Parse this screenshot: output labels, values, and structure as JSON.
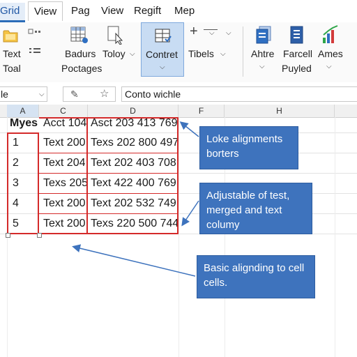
{
  "tabs": [
    {
      "label": "Grid"
    },
    {
      "label": "View"
    },
    {
      "label": "Pag"
    },
    {
      "label": "View"
    },
    {
      "label": "Regift"
    },
    {
      "label": "Mep"
    }
  ],
  "ribbon": {
    "text_tool": [
      "Text",
      "Toal"
    ],
    "badurs": [
      "Badurs",
      "Poctages"
    ],
    "toloy": "Toloy",
    "contret": "Contret",
    "tibels": "Tibels",
    "ahtre": "Ahtre",
    "farcell": [
      "Farcell",
      "Puyled"
    ],
    "ames": "Ames"
  },
  "formula_bar": {
    "name_box": "le",
    "content": "Conto wichle"
  },
  "columns": [
    "A",
    "C",
    "D",
    "F",
    "H"
  ],
  "table": {
    "header": [
      "Myes",
      "Acct 104",
      "Asct 203 413 769"
    ],
    "rows": [
      [
        "1",
        "Text 200",
        "Texs 202 800 497"
      ],
      [
        "2",
        "Text 204",
        "Text 202 403 708"
      ],
      [
        "3",
        "Texs 205",
        "Text 422 400 769"
      ],
      [
        "4",
        "Text 200",
        "Text 202 532 749"
      ],
      [
        "5",
        "Text 200",
        "Texs 220 500 744"
      ]
    ]
  },
  "callouts": {
    "c1": "Loke alignments borters",
    "c2": "Adjustable of test, merged and text columy",
    "c3": "Basic alignding to cell cells."
  },
  "colors": {
    "accent": "#3e73bd",
    "border_red": "#d42a2a",
    "tab_blue": "#1f56a4"
  }
}
